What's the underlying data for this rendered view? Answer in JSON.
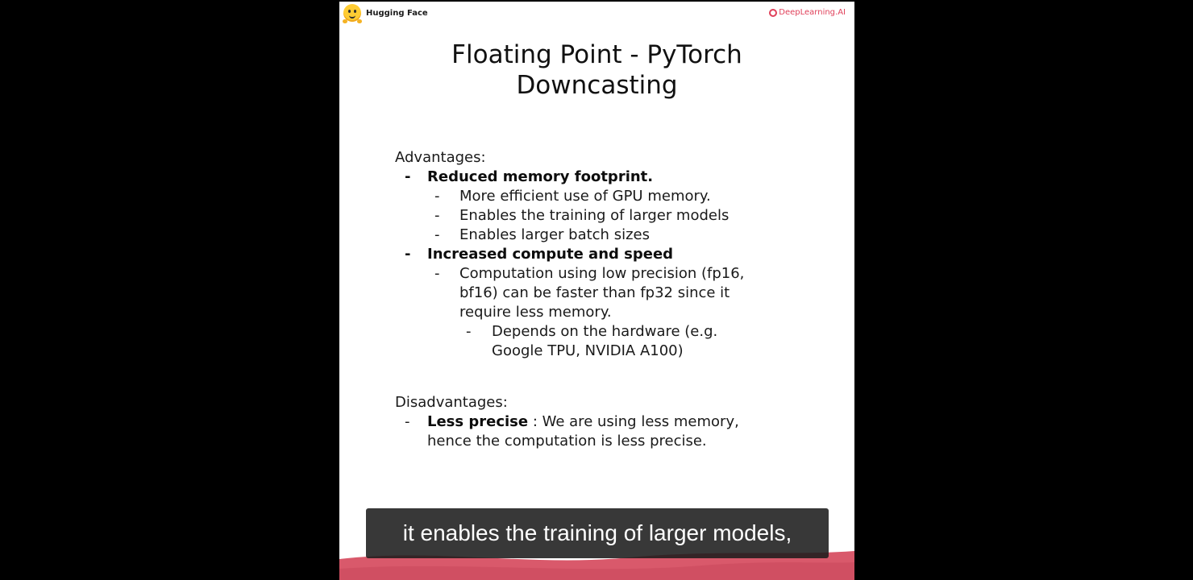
{
  "slide": {
    "brand_left": "Hugging Face",
    "brand_right": "DeepLearning.AI",
    "title_line1": "Floating Point - PyTorch",
    "title_line2": "Downcasting",
    "advantages_heading": "Advantages:",
    "bullet": "-",
    "adv_1": "Reduced memory footprint.",
    "adv_1_sub_1": "More efficient use of GPU memory.",
    "adv_1_sub_2": "Enables the training of larger models",
    "adv_1_sub_3": "Enables larger batch sizes",
    "adv_2": "Increased compute and speed",
    "adv_2_sub_1_line1": "Computation using low precision (fp16,",
    "adv_2_sub_1_line2": "bf16) can be faster than fp32 since it",
    "adv_2_sub_1_line3": "require less memory.",
    "adv_2_sub_1_sub_line1": "Depends on the hardware (e.g.",
    "adv_2_sub_1_sub_line2": "Google TPU, NVIDIA A100)",
    "disadvantages_heading": "Disadvantages:",
    "dis_1_bold": "Less precise",
    "dis_1_rest_line1": " : We are using less memory,",
    "dis_1_rest_line2": "hence the computation is less precise."
  },
  "caption": {
    "text": "it enables the training of larger models,"
  },
  "colors": {
    "background": "#000000",
    "slide": "#ffffff",
    "accent": "#e0405a",
    "wave": "#d9596b",
    "caption_bg": "#1c1c1c"
  },
  "icons": {
    "left_logo": "hugging-face-logo-icon",
    "right_logo": "deeplearning-ai-logo-icon"
  }
}
